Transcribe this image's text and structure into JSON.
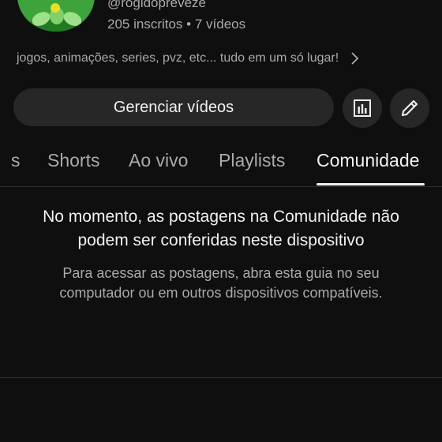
{
  "channel": {
    "handle": "@rogidopreveze",
    "stats": "205 inscritos • 7 vídeos",
    "description": "jogos, animações, series, pvz, etc... tudo em um só lugar!",
    "avatar_color": "#3ea33a"
  },
  "actions": {
    "manage_label": "Gerenciar vídeos",
    "analytics_icon": "analytics-icon",
    "edit_icon": "pencil-icon"
  },
  "tabs": [
    {
      "label": "s",
      "active": false
    },
    {
      "label": "Shorts",
      "active": false
    },
    {
      "label": "Ao vivo",
      "active": false
    },
    {
      "label": "Playlists",
      "active": false
    },
    {
      "label": "Comunidade",
      "active": true
    }
  ],
  "notice": {
    "title_line1": "No momento, as postagens na Comunidade não",
    "title_line2": "podem ser conferidas neste dispositivo",
    "body_line1": "Para acessar as postagens, abra esta guia no seu",
    "body_line2": "computador ou em outros dispositivos compatíveis."
  },
  "colors": {
    "background": "#0f0f0f",
    "surface": "#272727",
    "text_primary": "#f1f1f1",
    "text_secondary": "#aaaaaa"
  }
}
